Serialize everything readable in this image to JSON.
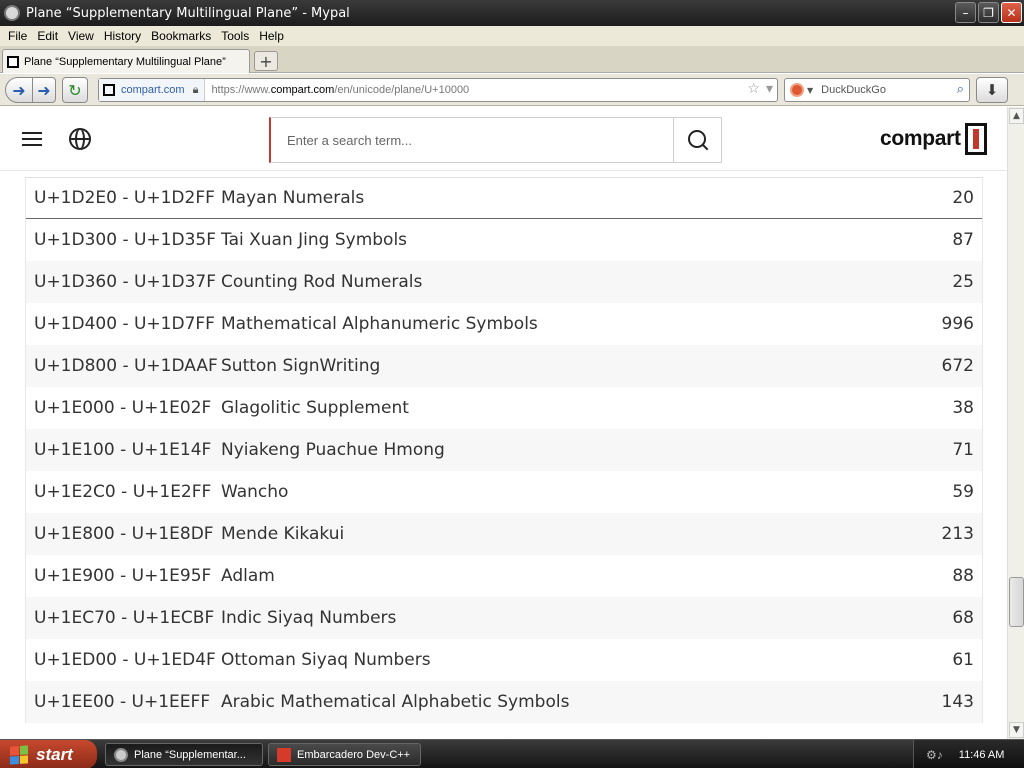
{
  "window": {
    "title": "Plane “Supplementary Multilingual Plane” - Mypal",
    "minimize": "–",
    "restore": "❐",
    "close": "✕"
  },
  "menu": [
    "File",
    "Edit",
    "View",
    "History",
    "Bookmarks",
    "Tools",
    "Help"
  ],
  "tab": {
    "label": "Plane “Supplementary Multilingual Plane”",
    "new_tab": "+"
  },
  "nav": {
    "identity_domain": "compart.com",
    "url_prefix": "https://www.",
    "url_host": "compart.com",
    "url_path": "/en/unicode/plane/U+10000",
    "search_placeholder": "DuckDuckGo"
  },
  "site": {
    "search_placeholder": "Enter a search term...",
    "logo_text": "compart"
  },
  "rows": [
    {
      "range": "U+1D2E0 - U+1D2FF",
      "name": "Mayan Numerals",
      "count": "20"
    },
    {
      "range": "U+1D300 - U+1D35F",
      "name": "Tai Xuan Jing Symbols",
      "count": "87"
    },
    {
      "range": "U+1D360 - U+1D37F",
      "name": "Counting Rod Numerals",
      "count": "25"
    },
    {
      "range": "U+1D400 - U+1D7FF",
      "name": "Mathematical Alphanumeric Symbols",
      "count": "996"
    },
    {
      "range": "U+1D800 - U+1DAAF",
      "name": "Sutton SignWriting",
      "count": "672"
    },
    {
      "range": "U+1E000 - U+1E02F",
      "name": "Glagolitic Supplement",
      "count": "38"
    },
    {
      "range": "U+1E100 - U+1E14F",
      "name": "Nyiakeng Puachue Hmong",
      "count": "71"
    },
    {
      "range": "U+1E2C0 - U+1E2FF",
      "name": "Wancho",
      "count": "59"
    },
    {
      "range": "U+1E800 - U+1E8DF",
      "name": "Mende Kikakui",
      "count": "213"
    },
    {
      "range": "U+1E900 - U+1E95F",
      "name": "Adlam",
      "count": "88"
    },
    {
      "range": "U+1EC70 - U+1ECBF",
      "name": "Indic Siyaq Numbers",
      "count": "68"
    },
    {
      "range": "U+1ED00 - U+1ED4F",
      "name": "Ottoman Siyaq Numbers",
      "count": "61"
    },
    {
      "range": "U+1EE00 - U+1EEFF",
      "name": "Arabic Mathematical Alphabetic Symbols",
      "count": "143"
    }
  ],
  "taskbar": {
    "start": "start",
    "items": [
      "Plane “Supplementar...",
      "Embarcadero Dev-C++"
    ],
    "clock": "11:46 AM"
  }
}
